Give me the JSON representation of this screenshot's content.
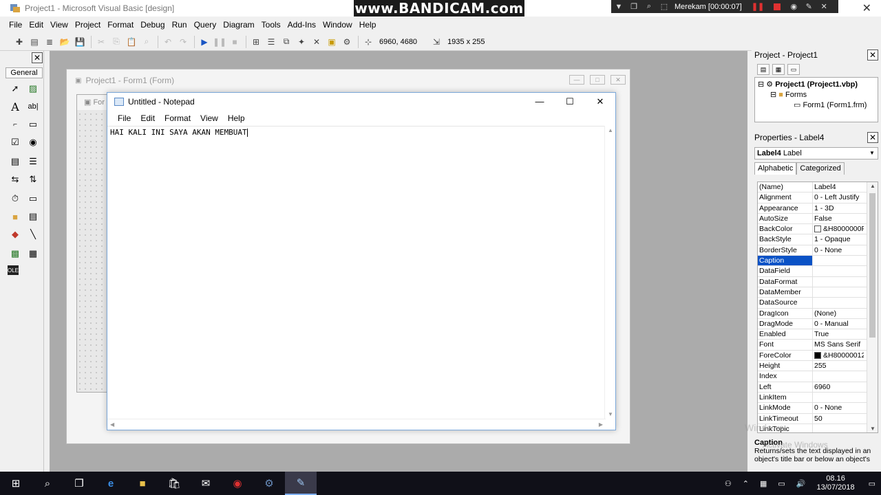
{
  "window": {
    "title": "Project1 - Microsoft Visual Basic [design]"
  },
  "recorder": {
    "watermark": "www.BANDICAM.com",
    "status": "Merekam [00:00:07]"
  },
  "menu": [
    "File",
    "Edit",
    "View",
    "Project",
    "Format",
    "Debug",
    "Run",
    "Query",
    "Diagram",
    "Tools",
    "Add-Ins",
    "Window",
    "Help"
  ],
  "toolbar": {
    "position": "6960, 4680",
    "size": "1935 x 255"
  },
  "toolbox": {
    "tab_label": "General"
  },
  "form_window": {
    "title": "Project1 - Form1 (Form)",
    "inner_title": "For"
  },
  "notepad": {
    "title": "Untitled - Notepad",
    "menu": [
      "File",
      "Edit",
      "Format",
      "View",
      "Help"
    ],
    "content": "HAI KALI INI SAYA AKAN MEMBUAT"
  },
  "project_panel": {
    "title": "Project - Project1",
    "tree": {
      "project": "Project1 (Project1.vbp)",
      "folder": "Forms",
      "form": "Form1 (Form1.frm)"
    }
  },
  "properties_panel": {
    "title": "Properties - Label4",
    "object_name": "Label4",
    "object_type": "Label",
    "tabs": [
      "Alphabetic",
      "Categorized"
    ],
    "rows": [
      {
        "name": "(Name)",
        "value": "Label4"
      },
      {
        "name": "Alignment",
        "value": "0 - Left Justify"
      },
      {
        "name": "Appearance",
        "value": "1 - 3D"
      },
      {
        "name": "AutoSize",
        "value": "False"
      },
      {
        "name": "BackColor",
        "value": "&H8000000F",
        "swatch": "#ffffff"
      },
      {
        "name": "BackStyle",
        "value": "1 - Opaque"
      },
      {
        "name": "BorderStyle",
        "value": "0 - None"
      },
      {
        "name": "Caption",
        "value": "",
        "selected": true
      },
      {
        "name": "DataField",
        "value": ""
      },
      {
        "name": "DataFormat",
        "value": ""
      },
      {
        "name": "DataMember",
        "value": ""
      },
      {
        "name": "DataSource",
        "value": ""
      },
      {
        "name": "DragIcon",
        "value": "(None)"
      },
      {
        "name": "DragMode",
        "value": "0 - Manual"
      },
      {
        "name": "Enabled",
        "value": "True"
      },
      {
        "name": "Font",
        "value": "MS Sans Serif"
      },
      {
        "name": "ForeColor",
        "value": "&H80000012",
        "swatch": "#000000"
      },
      {
        "name": "Height",
        "value": "255"
      },
      {
        "name": "Index",
        "value": ""
      },
      {
        "name": "Left",
        "value": "6960"
      },
      {
        "name": "LinkItem",
        "value": ""
      },
      {
        "name": "LinkMode",
        "value": "0 - None"
      },
      {
        "name": "LinkTimeout",
        "value": "50"
      },
      {
        "name": "LinkTopic",
        "value": ""
      }
    ],
    "description_title": "Caption",
    "description_text": "Returns/sets the text displayed in an object's title bar or below an object's"
  },
  "watermark_os": {
    "line1": "Windows",
    "line2": "Activate Windows"
  },
  "taskbar": {
    "time": "08.16",
    "date": "13/07/2018"
  },
  "colors": {
    "selection": "#0a52c6",
    "designer_bg": "#ababab",
    "taskbar_bg": "#101018"
  }
}
